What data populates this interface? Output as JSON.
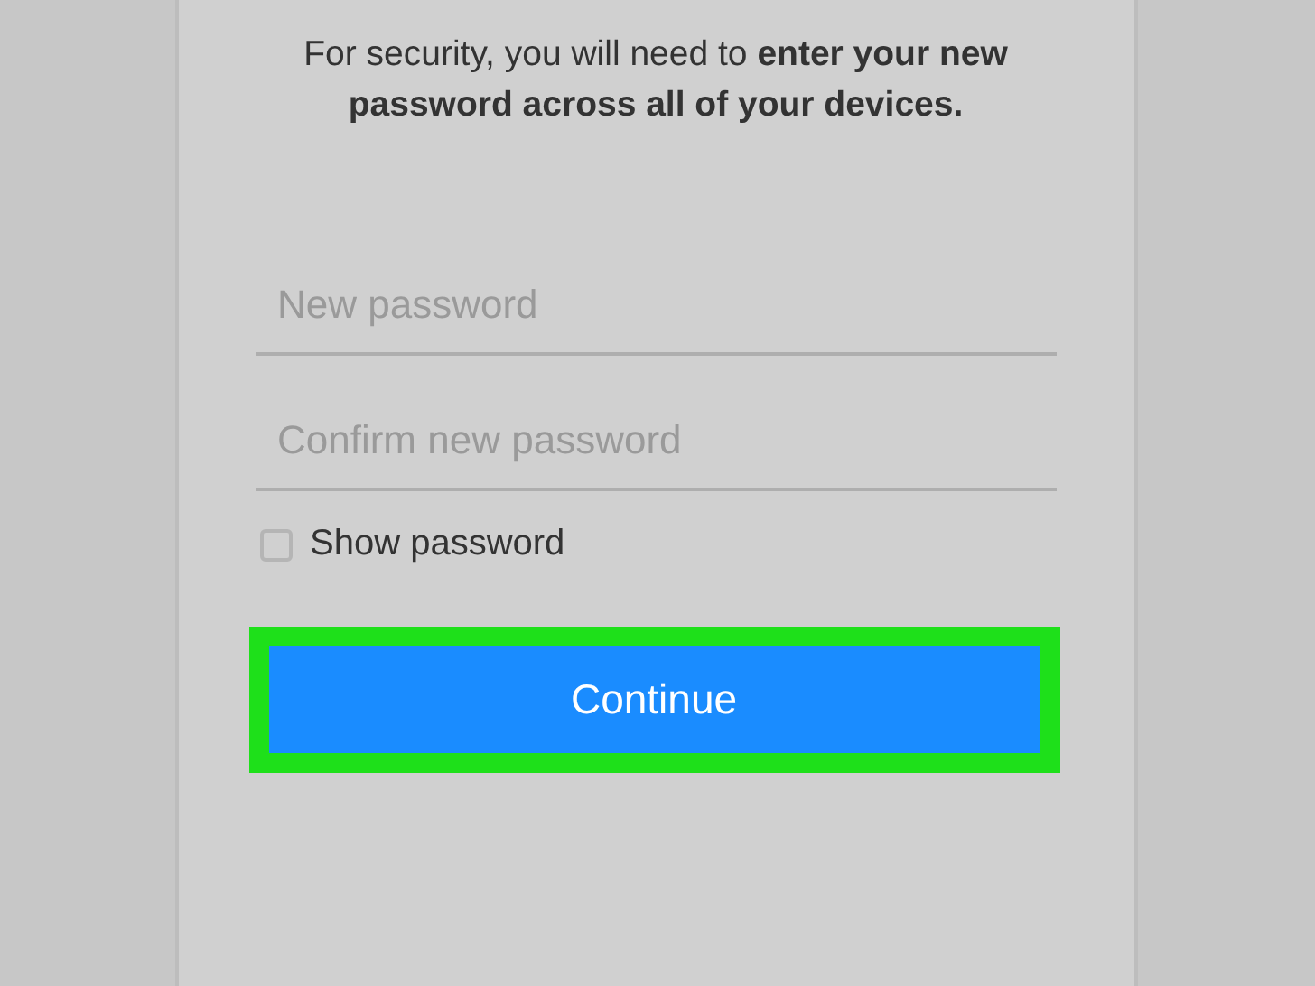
{
  "notice": "For security, you will need to **enter your new password across all of your devices.**",
  "fields": [
    {
      "placeholder": "New password"
    },
    {
      "placeholder": "Confirm new password"
    }
  ],
  "show_password": {
    "label": "Show password",
    "checked": false
  },
  "continue_button": {
    "label": "Continue",
    "highlighted": true
  }
}
